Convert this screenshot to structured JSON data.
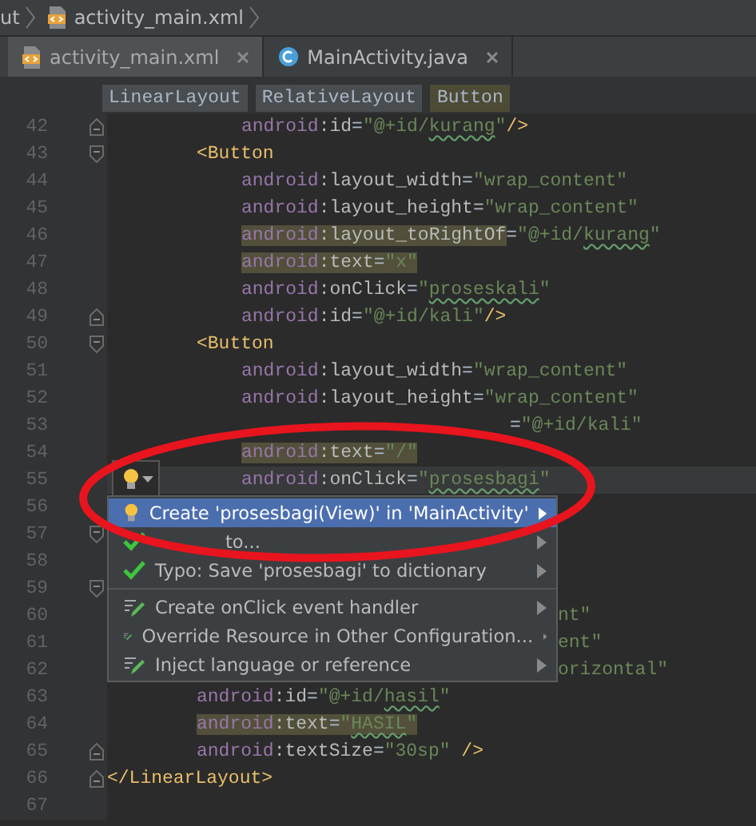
{
  "breadcrumb": {
    "items": [
      {
        "label": "ut",
        "kind": "folder"
      },
      {
        "label": "activity_main.xml",
        "kind": "xml"
      }
    ]
  },
  "tabs": [
    {
      "label": "activity_main.xml",
      "kind": "xml",
      "selected": true
    },
    {
      "label": "MainActivity.java",
      "kind": "class",
      "selected": false
    }
  ],
  "tag_path": [
    {
      "label": "LinearLayout",
      "selected": false
    },
    {
      "label": "RelativeLayout",
      "selected": false
    },
    {
      "label": "Button",
      "selected": true
    }
  ],
  "editor": {
    "lines": [
      {
        "number": "42",
        "kind": "attr",
        "fold": {
          "kind": "end"
        },
        "parts": [
          {
            "t": "android",
            "kind": "ns",
            "hl": false,
            "typo": false
          },
          {
            "t": ":id",
            "kind": "attr",
            "hl": false,
            "typo": false
          },
          {
            "t": "=",
            "kind": "eq",
            "hl": false,
            "typo": false
          },
          {
            "t": "\"@+id/",
            "kind": "str",
            "hl": false,
            "typo": false
          },
          {
            "t": "kurang",
            "kind": "str",
            "hl": false,
            "typo": true
          },
          {
            "t": "\"",
            "kind": "str",
            "hl": false,
            "typo": false
          },
          {
            "t": "/>",
            "kind": "tag",
            "hl": false,
            "typo": false
          }
        ]
      },
      {
        "number": "43",
        "kind": "tag",
        "fold": {
          "kind": "start"
        },
        "parts": [
          {
            "t": "<Button",
            "kind": "tag",
            "hl": false,
            "typo": false
          }
        ]
      },
      {
        "number": "44",
        "kind": "attr",
        "parts": [
          {
            "t": "android",
            "kind": "ns",
            "hl": false,
            "typo": false
          },
          {
            "t": ":layout_width",
            "kind": "attr",
            "hl": false,
            "typo": false
          },
          {
            "t": "=",
            "kind": "eq",
            "hl": false,
            "typo": false
          },
          {
            "t": "\"wrap_content\"",
            "kind": "str",
            "hl": false,
            "typo": false
          }
        ]
      },
      {
        "number": "45",
        "kind": "attr",
        "parts": [
          {
            "t": "android",
            "kind": "ns",
            "hl": false,
            "typo": false
          },
          {
            "t": ":layout_height",
            "kind": "attr",
            "hl": false,
            "typo": false
          },
          {
            "t": "=",
            "kind": "eq",
            "hl": false,
            "typo": false
          },
          {
            "t": "\"wrap_content\"",
            "kind": "str",
            "hl": false,
            "typo": false
          }
        ]
      },
      {
        "number": "46",
        "kind": "attr",
        "parts": [
          {
            "t": "android",
            "kind": "ns",
            "hl": true,
            "typo": false
          },
          {
            "t": ":layout_toRightOf",
            "kind": "attr",
            "hl": true,
            "typo": false
          },
          {
            "t": "=",
            "kind": "eq",
            "hl": false,
            "typo": false
          },
          {
            "t": "\"@+id/",
            "kind": "str",
            "hl": false,
            "typo": false
          },
          {
            "t": "kurang",
            "kind": "str",
            "hl": false,
            "typo": true
          },
          {
            "t": "\"",
            "kind": "str",
            "hl": false,
            "typo": false
          }
        ]
      },
      {
        "number": "47",
        "kind": "attr",
        "parts": [
          {
            "t": "android",
            "kind": "ns",
            "hl": true,
            "typo": false
          },
          {
            "t": ":text",
            "kind": "attr",
            "hl": true,
            "typo": false
          },
          {
            "t": "=",
            "kind": "eq",
            "hl": true,
            "typo": false
          },
          {
            "t": "\"x\"",
            "kind": "str",
            "hl": true,
            "typo": false
          }
        ]
      },
      {
        "number": "48",
        "kind": "attr",
        "parts": [
          {
            "t": "android",
            "kind": "ns",
            "hl": false,
            "typo": false
          },
          {
            "t": ":onClick",
            "kind": "attr",
            "hl": false,
            "typo": false
          },
          {
            "t": "=",
            "kind": "eq",
            "hl": false,
            "typo": false
          },
          {
            "t": "\"",
            "kind": "str",
            "hl": false,
            "typo": false
          },
          {
            "t": "proseskali",
            "kind": "str",
            "hl": false,
            "typo": true
          },
          {
            "t": "\"",
            "kind": "str",
            "hl": false,
            "typo": false
          }
        ]
      },
      {
        "number": "49",
        "kind": "attr",
        "fold": {
          "kind": "end"
        },
        "parts": [
          {
            "t": "android",
            "kind": "ns",
            "hl": false,
            "typo": false
          },
          {
            "t": ":id",
            "kind": "attr",
            "hl": false,
            "typo": false
          },
          {
            "t": "=",
            "kind": "eq",
            "hl": false,
            "typo": false
          },
          {
            "t": "\"@+id/kali\"",
            "kind": "str",
            "hl": false,
            "typo": false
          },
          {
            "t": "/>",
            "kind": "tag",
            "hl": false,
            "typo": false
          }
        ]
      },
      {
        "number": "50",
        "kind": "tag",
        "fold": {
          "kind": "start"
        },
        "parts": [
          {
            "t": "<Button",
            "kind": "tag",
            "hl": false,
            "typo": false
          }
        ]
      },
      {
        "number": "51",
        "kind": "attr",
        "parts": [
          {
            "t": "android",
            "kind": "ns",
            "hl": false,
            "typo": false
          },
          {
            "t": ":layout_width",
            "kind": "attr",
            "hl": false,
            "typo": false
          },
          {
            "t": "=",
            "kind": "eq",
            "hl": false,
            "typo": false
          },
          {
            "t": "\"wrap_content\"",
            "kind": "str",
            "hl": false,
            "typo": false
          }
        ]
      },
      {
        "number": "52",
        "kind": "attr",
        "parts": [
          {
            "t": "android",
            "kind": "ns",
            "hl": false,
            "typo": false
          },
          {
            "t": ":layout_height",
            "kind": "attr",
            "hl": false,
            "typo": false
          },
          {
            "t": "=",
            "kind": "eq",
            "hl": false,
            "typo": false
          },
          {
            "t": "\"wrap_content\"",
            "kind": "str",
            "hl": false,
            "typo": false
          }
        ]
      },
      {
        "number": "53",
        "kind": "cut",
        "parts": [
          {
            "t": "=",
            "kind": "eq",
            "hl": false,
            "typo": false
          },
          {
            "t": "\"@+id/kali\"",
            "kind": "str",
            "hl": false,
            "typo": false
          }
        ]
      },
      {
        "number": "54",
        "kind": "attr",
        "parts": [
          {
            "t": "android",
            "kind": "ns",
            "hl": true,
            "typo": false
          },
          {
            "t": ":text",
            "kind": "attr",
            "hl": true,
            "typo": false
          },
          {
            "t": "=",
            "kind": "eq",
            "hl": true,
            "typo": false
          },
          {
            "t": "\"/\"",
            "kind": "str",
            "hl": true,
            "typo": false
          }
        ]
      },
      {
        "number": "55",
        "kind": "attr",
        "current": true,
        "gutter_icon": {
          "kind": "bulb"
        },
        "parts": [
          {
            "t": "android",
            "kind": "ns",
            "hl": false,
            "typo": false
          },
          {
            "t": ":onClick",
            "kind": "attr",
            "hl": false,
            "typo": false
          },
          {
            "t": "=",
            "kind": "eq",
            "hl": false,
            "typo": false
          },
          {
            "t": "\"",
            "kind": "str",
            "hl": false,
            "typo": false
          },
          {
            "t": "prosesbagi",
            "kind": "str",
            "hl": false,
            "typo": true
          },
          {
            "t": "\"",
            "kind": "str",
            "hl": false,
            "typo": false
          }
        ]
      },
      {
        "number": "56"
      },
      {
        "number": "57",
        "fold": {
          "kind": "start"
        }
      },
      {
        "number": "58"
      },
      {
        "number": "59",
        "fold": {
          "kind": "start"
        }
      },
      {
        "number": "60",
        "kind": "tail",
        "parts": [
          {
            "t": "nt\"",
            "kind": "str",
            "hl": false,
            "typo": false
          }
        ]
      },
      {
        "number": "61",
        "kind": "tail",
        "parts": [
          {
            "t": "ent\"",
            "kind": "str",
            "hl": false,
            "typo": false
          }
        ]
      },
      {
        "number": "62",
        "kind": "tail",
        "parts": [
          {
            "t": "orizontal\"",
            "kind": "str",
            "hl": false,
            "typo": false
          }
        ]
      },
      {
        "number": "63",
        "kind": "inner",
        "parts": [
          {
            "t": "android",
            "kind": "ns",
            "hl": false,
            "typo": false
          },
          {
            "t": ":id",
            "kind": "attr",
            "hl": false,
            "typo": false
          },
          {
            "t": "=",
            "kind": "eq",
            "hl": false,
            "typo": false
          },
          {
            "t": "\"@+id/",
            "kind": "str",
            "hl": false,
            "typo": false
          },
          {
            "t": "hasil",
            "kind": "str",
            "hl": false,
            "typo": true
          },
          {
            "t": "\"",
            "kind": "str",
            "hl": false,
            "typo": false
          }
        ]
      },
      {
        "number": "64",
        "kind": "inner",
        "parts": [
          {
            "t": "android",
            "kind": "ns",
            "hl": true,
            "typo": false
          },
          {
            "t": ":text",
            "kind": "attr",
            "hl": true,
            "typo": false
          },
          {
            "t": "=",
            "kind": "eq",
            "hl": true,
            "typo": false
          },
          {
            "t": "\"",
            "kind": "str",
            "hl": true,
            "typo": false
          },
          {
            "t": "HASIL",
            "kind": "str",
            "hl": true,
            "typo": true
          },
          {
            "t": "\"",
            "kind": "str",
            "hl": true,
            "typo": false
          }
        ]
      },
      {
        "number": "65",
        "kind": "inner",
        "fold": {
          "kind": "end"
        },
        "parts": [
          {
            "t": "android",
            "kind": "ns",
            "hl": false,
            "typo": false
          },
          {
            "t": ":textSize",
            "kind": "attr",
            "hl": false,
            "typo": false
          },
          {
            "t": "=",
            "kind": "eq",
            "hl": false,
            "typo": false
          },
          {
            "t": "\"30sp\"",
            "kind": "str",
            "hl": false,
            "typo": false
          },
          {
            "t": " />",
            "kind": "tag",
            "hl": false,
            "typo": false
          }
        ]
      },
      {
        "number": "66",
        "kind": "root",
        "fold": {
          "kind": "end"
        },
        "parts": [
          {
            "t": "</LinearLayout>",
            "kind": "tag",
            "hl": false,
            "typo": false
          }
        ]
      },
      {
        "number": "67"
      }
    ]
  },
  "intention_menu": {
    "items": [
      {
        "label": "Create 'prosesbagi(View)' in 'MainActivity'",
        "kind": "bulb",
        "selected": true,
        "separator_before": false
      },
      {
        "label": "to...",
        "kind": "check_covered",
        "selected": false,
        "separator_before": false
      },
      {
        "label": "Typo: Save 'prosesbagi' to dictionary",
        "kind": "check",
        "selected": false,
        "separator_before": false
      },
      {
        "label": "Create onClick event handler",
        "kind": "pencil",
        "selected": false,
        "separator_before": true
      },
      {
        "label": "Override Resource in Other Configuration...",
        "kind": "pencil",
        "selected": false,
        "separator_before": false
      },
      {
        "label": "Inject language or reference",
        "kind": "pencil",
        "selected": false,
        "separator_before": false
      }
    ]
  },
  "annotations": [
    {
      "kind": "ellipse"
    }
  ]
}
